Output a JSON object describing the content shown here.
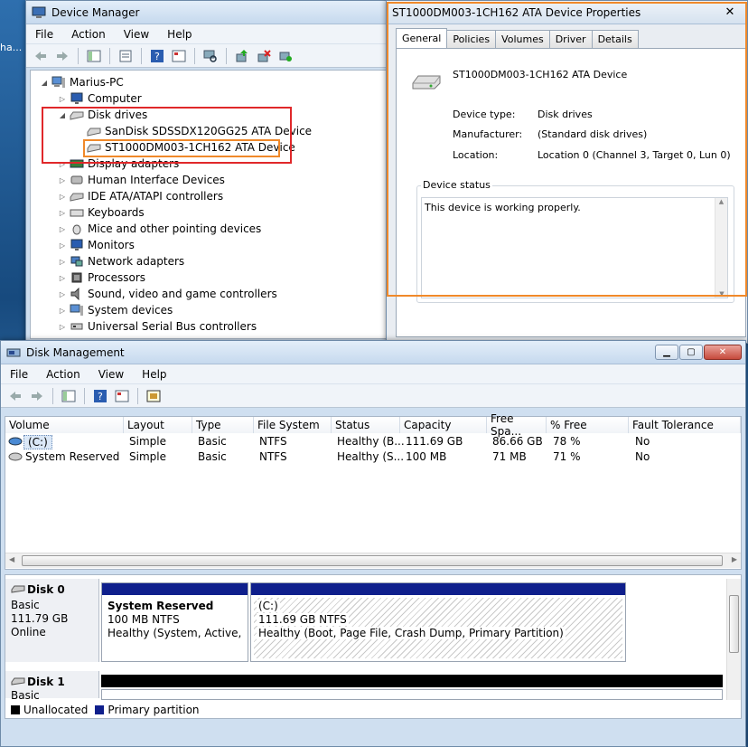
{
  "desktop": {
    "label": "ha..."
  },
  "device_manager": {
    "title": "Device Manager",
    "menu": [
      "File",
      "Action",
      "View",
      "Help"
    ],
    "tree": {
      "root": "Marius-PC",
      "computer": "Computer",
      "disk_drives": "Disk drives",
      "disk1": "SanDisk SDSSDX120GG25 ATA Device",
      "disk2": "ST1000DM003-1CH162 ATA Device",
      "display": "Display adapters",
      "hid": "Human Interface Devices",
      "ide": "IDE ATA/ATAPI controllers",
      "keyboards": "Keyboards",
      "mice": "Mice and other pointing devices",
      "monitors": "Monitors",
      "network": "Network adapters",
      "processors": "Processors",
      "sound": "Sound, video and game controllers",
      "system": "System devices",
      "usb": "Universal Serial Bus controllers"
    }
  },
  "properties": {
    "title": "ST1000DM003-1CH162 ATA Device Properties",
    "close": "✕",
    "tabs": [
      "General",
      "Policies",
      "Volumes",
      "Driver",
      "Details"
    ],
    "device_name": "ST1000DM003-1CH162 ATA Device",
    "device_type_label": "Device type:",
    "device_type": "Disk drives",
    "manufacturer_label": "Manufacturer:",
    "manufacturer": "(Standard disk drives)",
    "location_label": "Location:",
    "location": "Location 0 (Channel 3, Target 0, Lun 0)",
    "status_group": "Device status",
    "status_text": "This device is working properly."
  },
  "disk_management": {
    "title": "Disk Management",
    "menu": [
      "File",
      "Action",
      "View",
      "Help"
    ],
    "columns": [
      "Volume",
      "Layout",
      "Type",
      "File System",
      "Status",
      "Capacity",
      "Free Spa...",
      "% Free",
      "Fault Tolerance"
    ],
    "rows": [
      [
        "(C:)",
        "Simple",
        "Basic",
        "NTFS",
        "Healthy (B...",
        "111.69 GB",
        "86.66 GB",
        "78 %",
        "No"
      ],
      [
        "System Reserved",
        "Simple",
        "Basic",
        "NTFS",
        "Healthy (S...",
        "100 MB",
        "71 MB",
        "71 %",
        "No"
      ]
    ],
    "disk0": {
      "name": "Disk 0",
      "type": "Basic",
      "size": "111.79 GB",
      "state": "Online",
      "p1_name": "System Reserved",
      "p1_size": "100 MB NTFS",
      "p1_status": "Healthy (System, Active, Prir",
      "p2_name": "(C:)",
      "p2_size": "111.69 GB NTFS",
      "p2_status": "Healthy (Boot, Page File, Crash Dump, Primary Partition)"
    },
    "disk1": {
      "name": "Disk 1",
      "type": "Basic"
    },
    "legend": {
      "unallocated": "Unallocated",
      "primary": "Primary partition",
      "unallocated_color": "#000000",
      "primary_color": "#0f1f8c"
    }
  },
  "colors": {
    "red_highlight": "#e0282a",
    "orange_highlight": "#f0892a"
  }
}
